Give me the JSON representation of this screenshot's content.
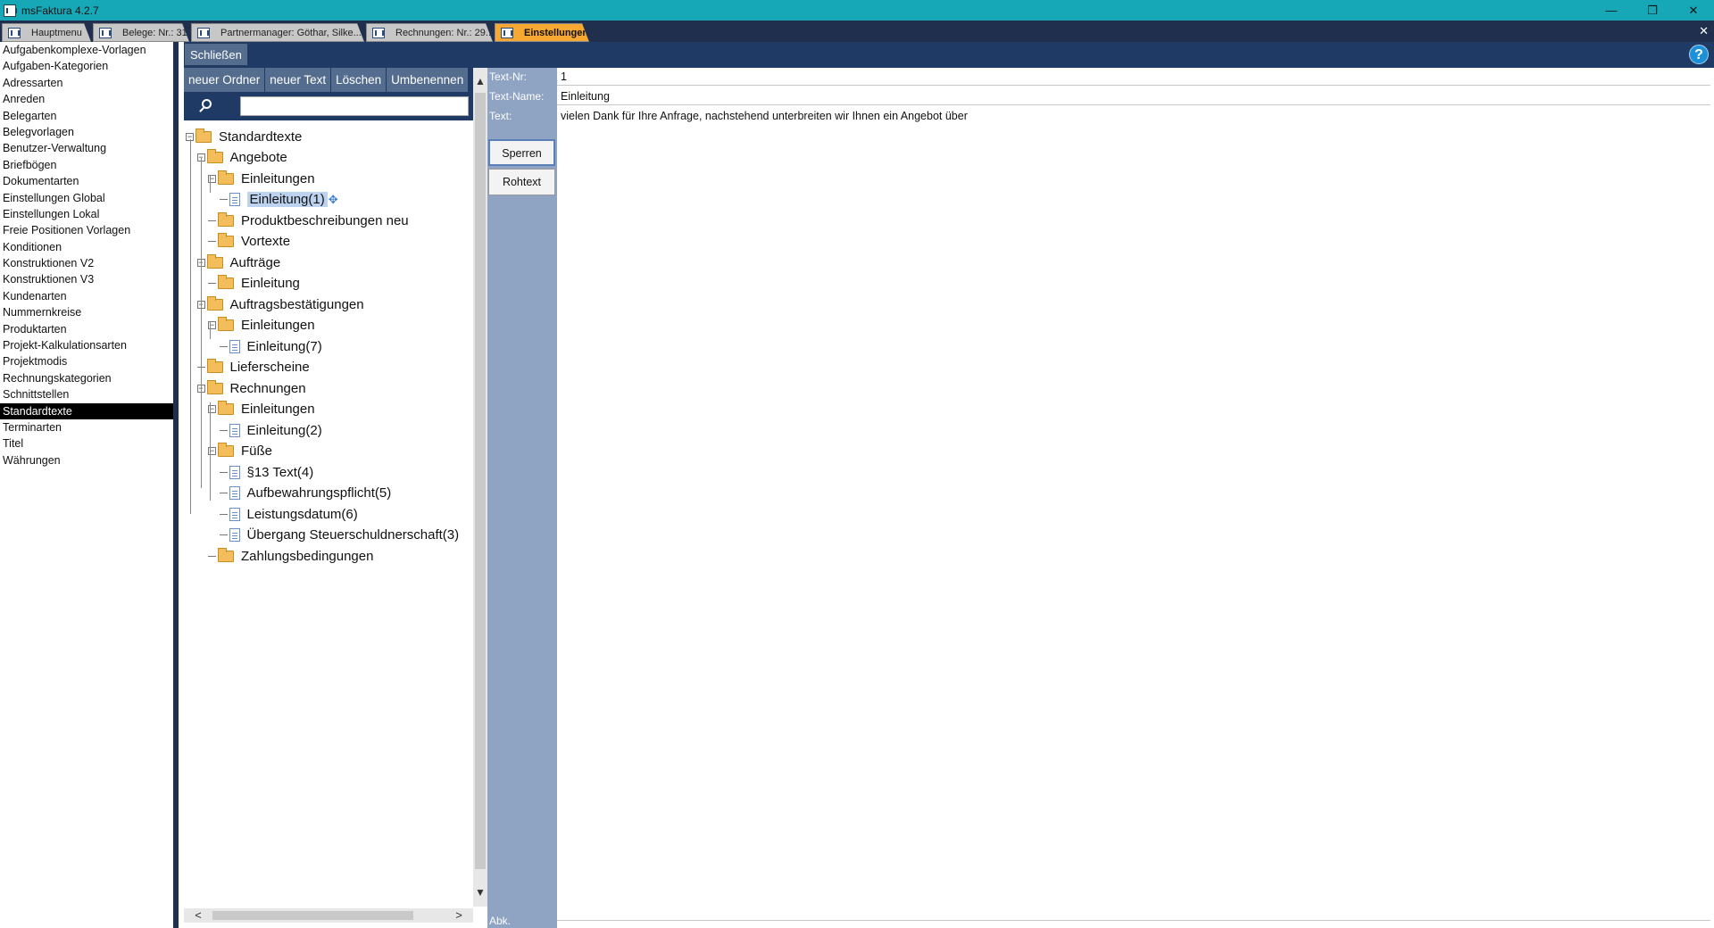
{
  "window": {
    "title": "msFaktura 4.2.7",
    "minimize_icon": "minimize-icon",
    "restore_icon": "restore-icon",
    "close_icon": "close-icon"
  },
  "tabs": [
    {
      "label": "Hauptmenu",
      "active": false
    },
    {
      "label": "Belege: Nr.: 31...",
      "active": false
    },
    {
      "label": "Partnermanager: Göthar, Silke...",
      "active": false
    },
    {
      "label": "Rechnungen: Nr.: 29...",
      "active": false
    },
    {
      "label": "Einstellungen",
      "active": true
    }
  ],
  "sidebar": {
    "items": [
      "Aufgabenkomplexe-Vorlagen",
      "Aufgaben-Kategorien",
      "Adressarten",
      "Anreden",
      "Belegarten",
      "Belegvorlagen",
      "Benutzer-Verwaltung",
      "Briefbögen",
      "Dokumentarten",
      "Einstellungen Global",
      "Einstellungen Lokal",
      "Freie Positionen Vorlagen",
      "Konditionen",
      "Konstruktionen V2",
      "Konstruktionen V3",
      "Kundenarten",
      "Nummernkreise",
      "Produktarten",
      "Projekt-Kalkulationsarten",
      "Projektmodis",
      "Rechnungskategorien",
      "Schnittstellen",
      "Standardtexte",
      "Terminarten",
      "Titel",
      "Währungen"
    ],
    "selected": "Standardtexte"
  },
  "toolbar": {
    "close_label": "Schließen",
    "help_label": "?"
  },
  "tree_toolbar": {
    "new_folder": "neuer Ordner",
    "new_text": "neuer Text",
    "delete": "Löschen",
    "rename": "Umbenennen",
    "search_value": ""
  },
  "tree": {
    "nodes": [
      {
        "label": "Standardtexte",
        "type": "folder",
        "depth": 0,
        "expander": "minus"
      },
      {
        "label": "Angebote",
        "type": "folder",
        "depth": 1,
        "expander": "minus"
      },
      {
        "label": "Einleitungen",
        "type": "folder",
        "depth": 2,
        "expander": "minus"
      },
      {
        "label": "Einleitung(1)",
        "type": "doc",
        "depth": 3,
        "expander": "dash",
        "selected": true
      },
      {
        "label": "Produktbeschreibungen neu",
        "type": "folder",
        "depth": 2,
        "expander": "dash"
      },
      {
        "label": "Vortexte",
        "type": "folder",
        "depth": 2,
        "expander": "dash"
      },
      {
        "label": "Aufträge",
        "type": "folder",
        "depth": 1,
        "expander": "minus"
      },
      {
        "label": "Einleitung",
        "type": "folder",
        "depth": 2,
        "expander": "dash"
      },
      {
        "label": "Auftragsbestätigungen",
        "type": "folder",
        "depth": 1,
        "expander": "minus"
      },
      {
        "label": "Einleitungen",
        "type": "folder",
        "depth": 2,
        "expander": "minus"
      },
      {
        "label": "Einleitung(7)",
        "type": "doc",
        "depth": 3,
        "expander": "dash"
      },
      {
        "label": "Lieferscheine",
        "type": "folder",
        "depth": 1,
        "expander": "dash"
      },
      {
        "label": "Rechnungen",
        "type": "folder",
        "depth": 1,
        "expander": "minus"
      },
      {
        "label": "Einleitungen",
        "type": "folder",
        "depth": 2,
        "expander": "minus"
      },
      {
        "label": "Einleitung(2)",
        "type": "doc",
        "depth": 3,
        "expander": "dash"
      },
      {
        "label": "Füße",
        "type": "folder",
        "depth": 2,
        "expander": "minus"
      },
      {
        "label": "§13 Text(4)",
        "type": "doc",
        "depth": 3,
        "expander": "dash"
      },
      {
        "label": "Aufbewahrungspflicht(5)",
        "type": "doc",
        "depth": 3,
        "expander": "dash"
      },
      {
        "label": "Leistungsdatum(6)",
        "type": "doc",
        "depth": 3,
        "expander": "dash"
      },
      {
        "label": "Übergang Steuerschuldnerschaft(3)",
        "type": "doc",
        "depth": 3,
        "expander": "dash"
      },
      {
        "label": "Zahlungsbedingungen",
        "type": "folder",
        "depth": 2,
        "expander": "dash"
      }
    ]
  },
  "detail": {
    "text_nr_label": "Text-Nr:",
    "text_nr_value": "1",
    "text_name_label": "Text-Name:",
    "text_name_value": "Einleitung",
    "text_label": "Text:",
    "text_value": "vielen Dank für Ihre Anfrage, nachstehend unterbreiten wir Ihnen ein Angebot über",
    "lock_button": "Sperren",
    "raw_text_button": "Rohtext",
    "abk_label": "Abk."
  }
}
